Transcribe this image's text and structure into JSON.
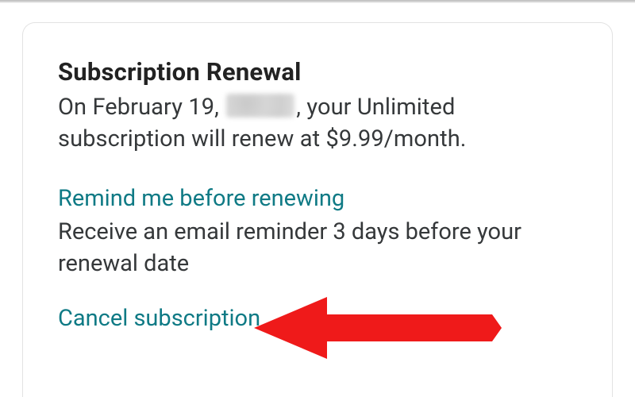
{
  "card": {
    "title": "Subscription Renewal",
    "renewal_line_prefix": "On February 19, ",
    "renewal_line_suffix": ", your Unlimited subscription will renew at $9.99/month.",
    "remind_link": "Remind me before renewing",
    "remind_desc": "Receive an email reminder 3 days before your renewal date",
    "cancel_link": "Cancel subscription"
  },
  "colors": {
    "link": "#0f7a85",
    "arrow": "#ef1a1a"
  }
}
